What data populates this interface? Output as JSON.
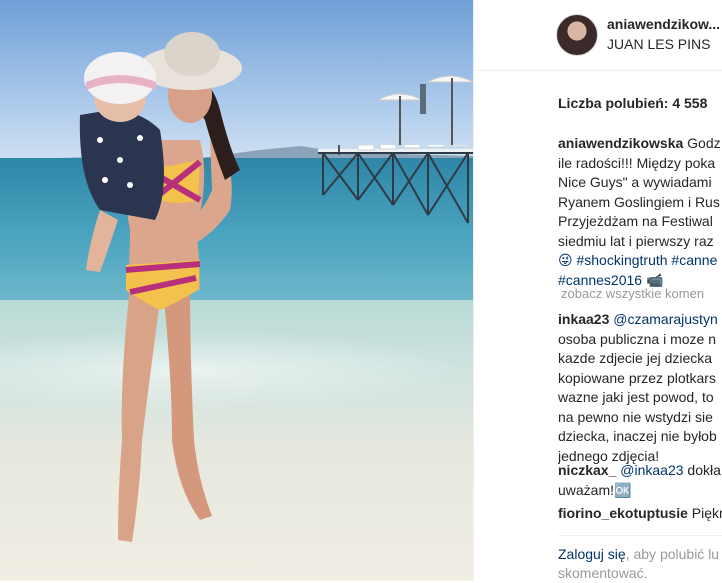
{
  "post": {
    "username": "aniawendzikow...",
    "location": "JUAN LES PINS",
    "likes": "Liczba polubień: 4 558"
  },
  "caption": {
    "user": "aniawendzikowska",
    "lines": [
      "Godz",
      "ile radości!!! Między poka",
      "Nice Guys\" a wywiadami",
      "Ryanem Goslingiem i Rus",
      "Przyjeżdżam na Festiwal",
      "siedmiu lat i pierwszy raz",
      "😜 #shockingtruth #canne",
      "#cannes2016 📹"
    ]
  },
  "view_all": "zobacz wszystkie komen",
  "comments": [
    {
      "user": "inkaa23",
      "mention": "@czamarajustyn",
      "lines": [
        "osoba publiczna i moze n",
        "kazde zdjecie jej dziecka",
        "kopiowane przez plotkars",
        "wazne jaki jest powod, to",
        "na pewno nie wstydzi sie",
        "dziecka, inaczej nie byłob",
        "jednego zdjęcia!"
      ]
    },
    {
      "user": "niczkax_",
      "mention": "@inkaa23",
      "first_rest": "dokła",
      "lines": [
        "uważam!🆗"
      ]
    },
    {
      "user": "fiorino_ekotuptusie",
      "first_rest": "Piękn"
    }
  ],
  "login": {
    "link": "Zaloguj się",
    "rest": ", aby polubić lu",
    "line2": "skomentować."
  },
  "colors": {
    "accent": "#003569",
    "muted": "#999999",
    "text": "#262626"
  }
}
